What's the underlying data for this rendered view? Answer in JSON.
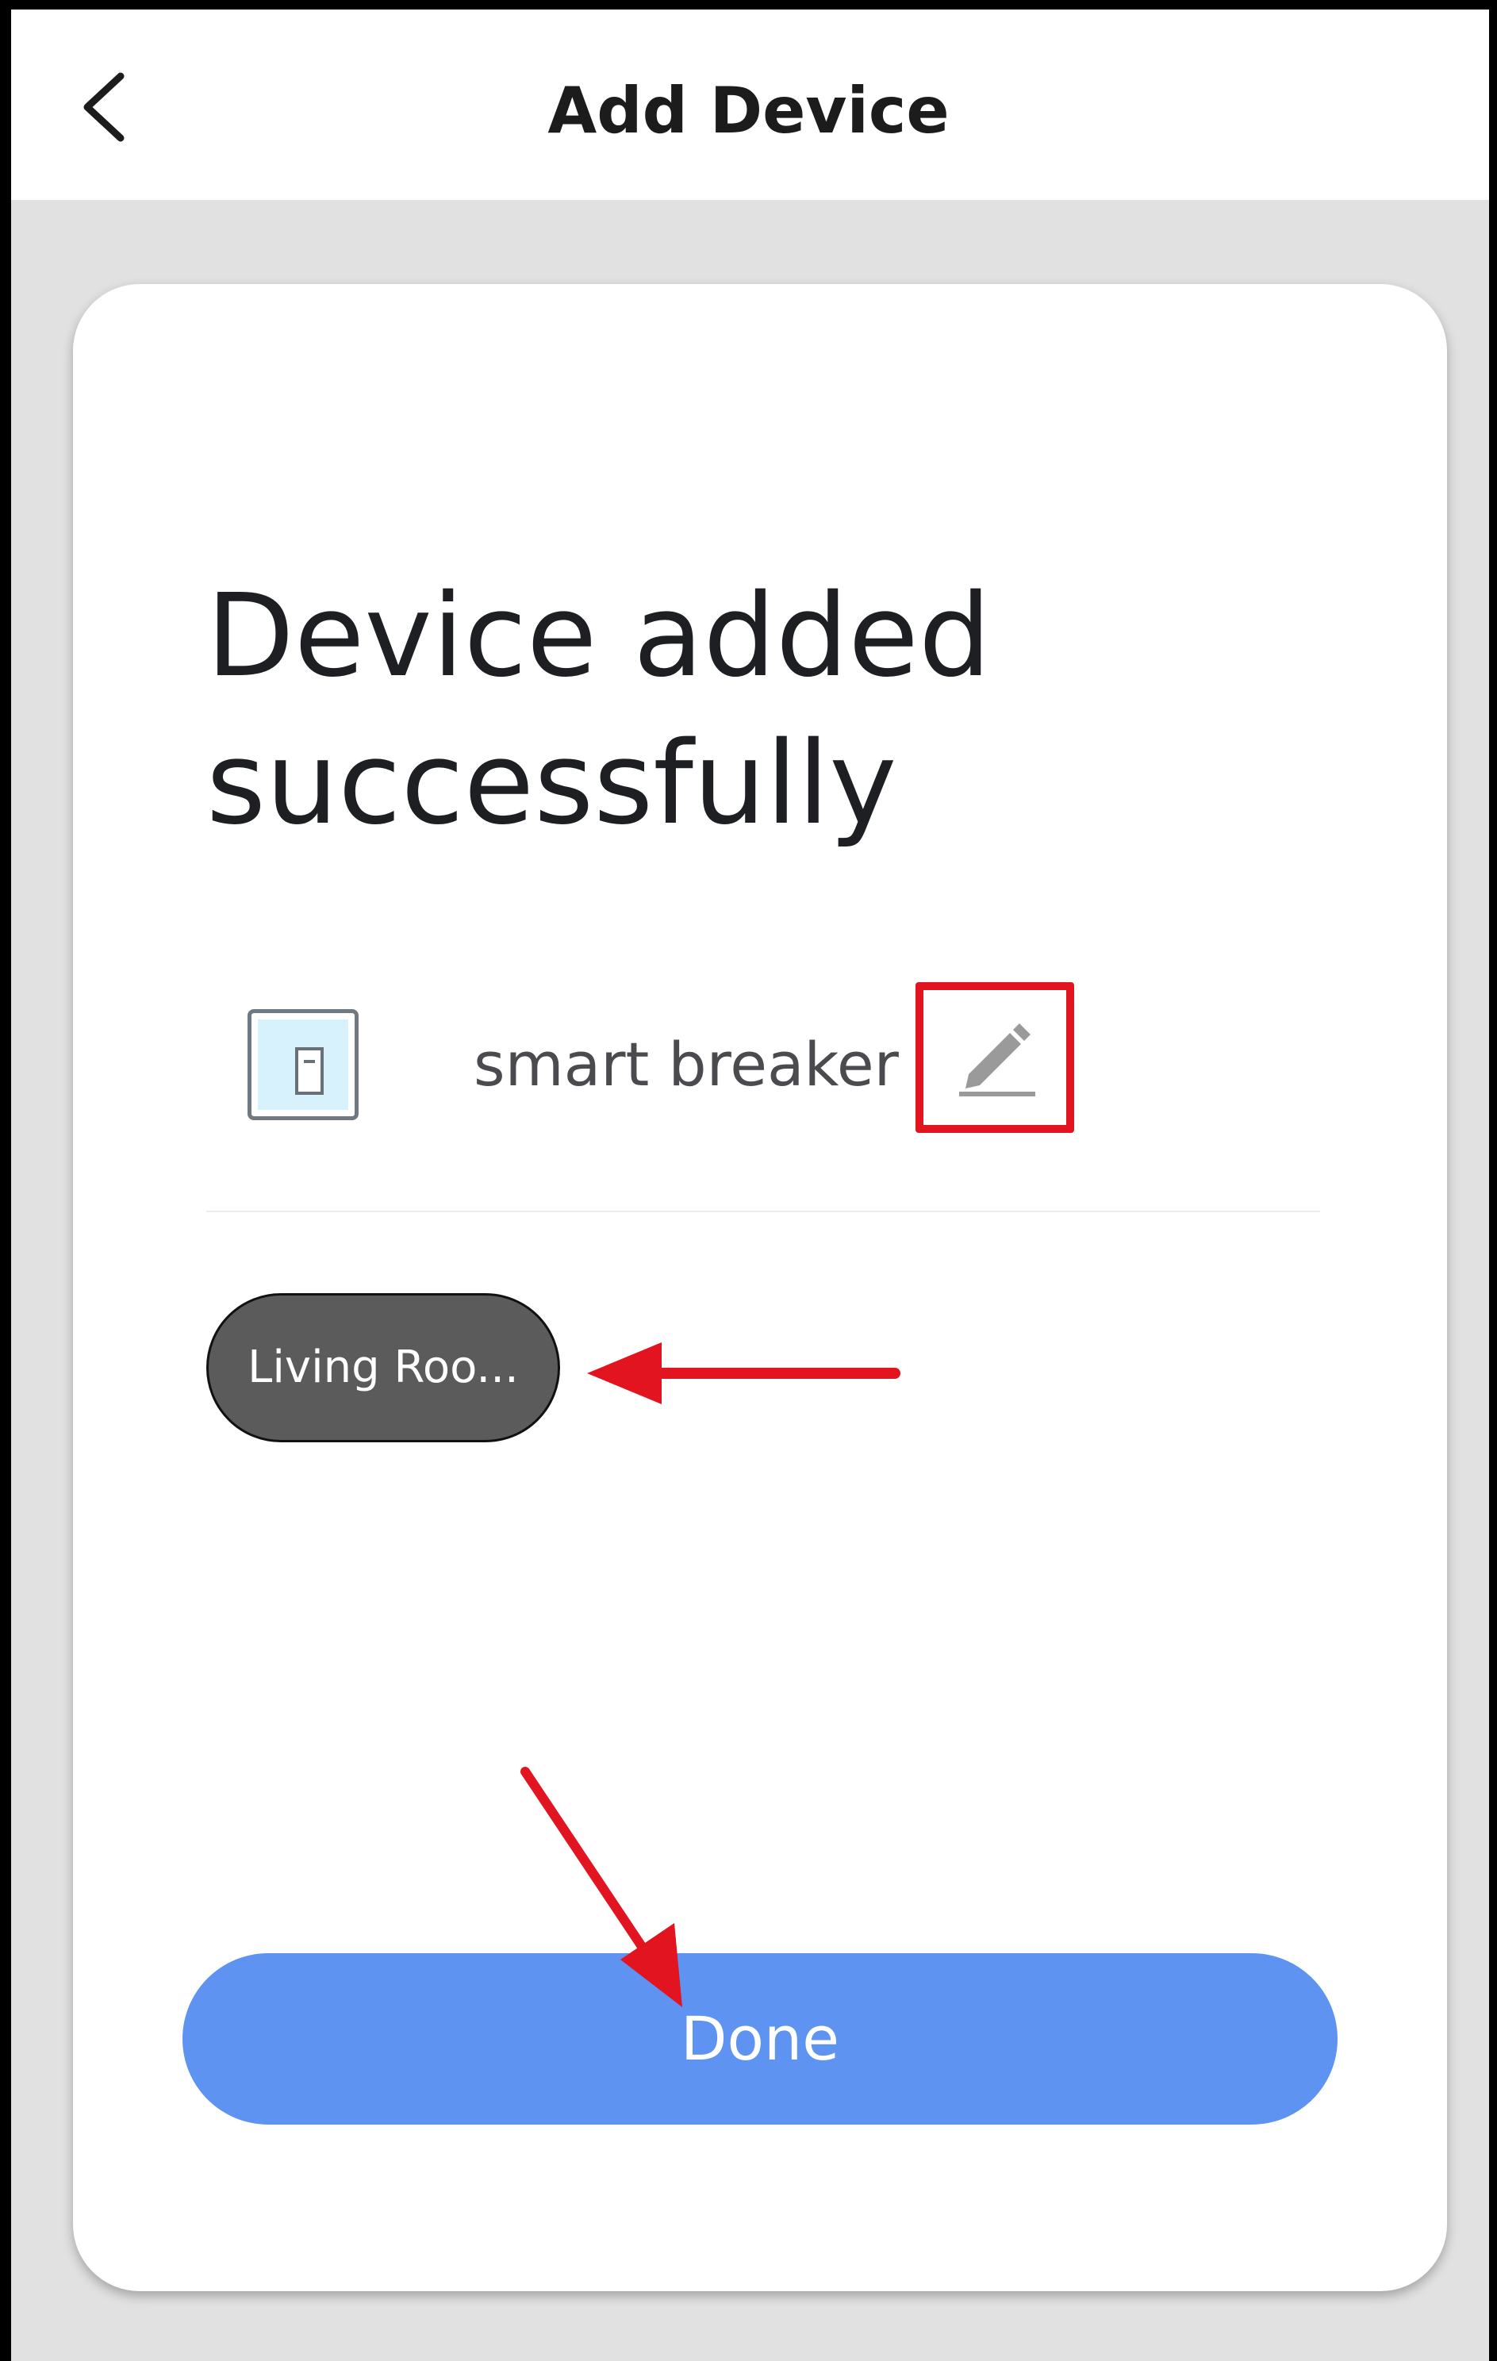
{
  "header": {
    "title": "Add Device",
    "back_icon": "chevron-left-icon"
  },
  "card": {
    "heading": "Device added successfully"
  },
  "device": {
    "name": "smart breaker",
    "icon": "switch-icon",
    "edit_icon": "pencil-icon"
  },
  "room": {
    "label": "Living Roo..."
  },
  "actions": {
    "done_label": "Done"
  },
  "colors": {
    "primary": "#5e93f1",
    "annotation": "#e2141f",
    "chip": "#5b5b5b",
    "background": "#e1e1e1"
  }
}
